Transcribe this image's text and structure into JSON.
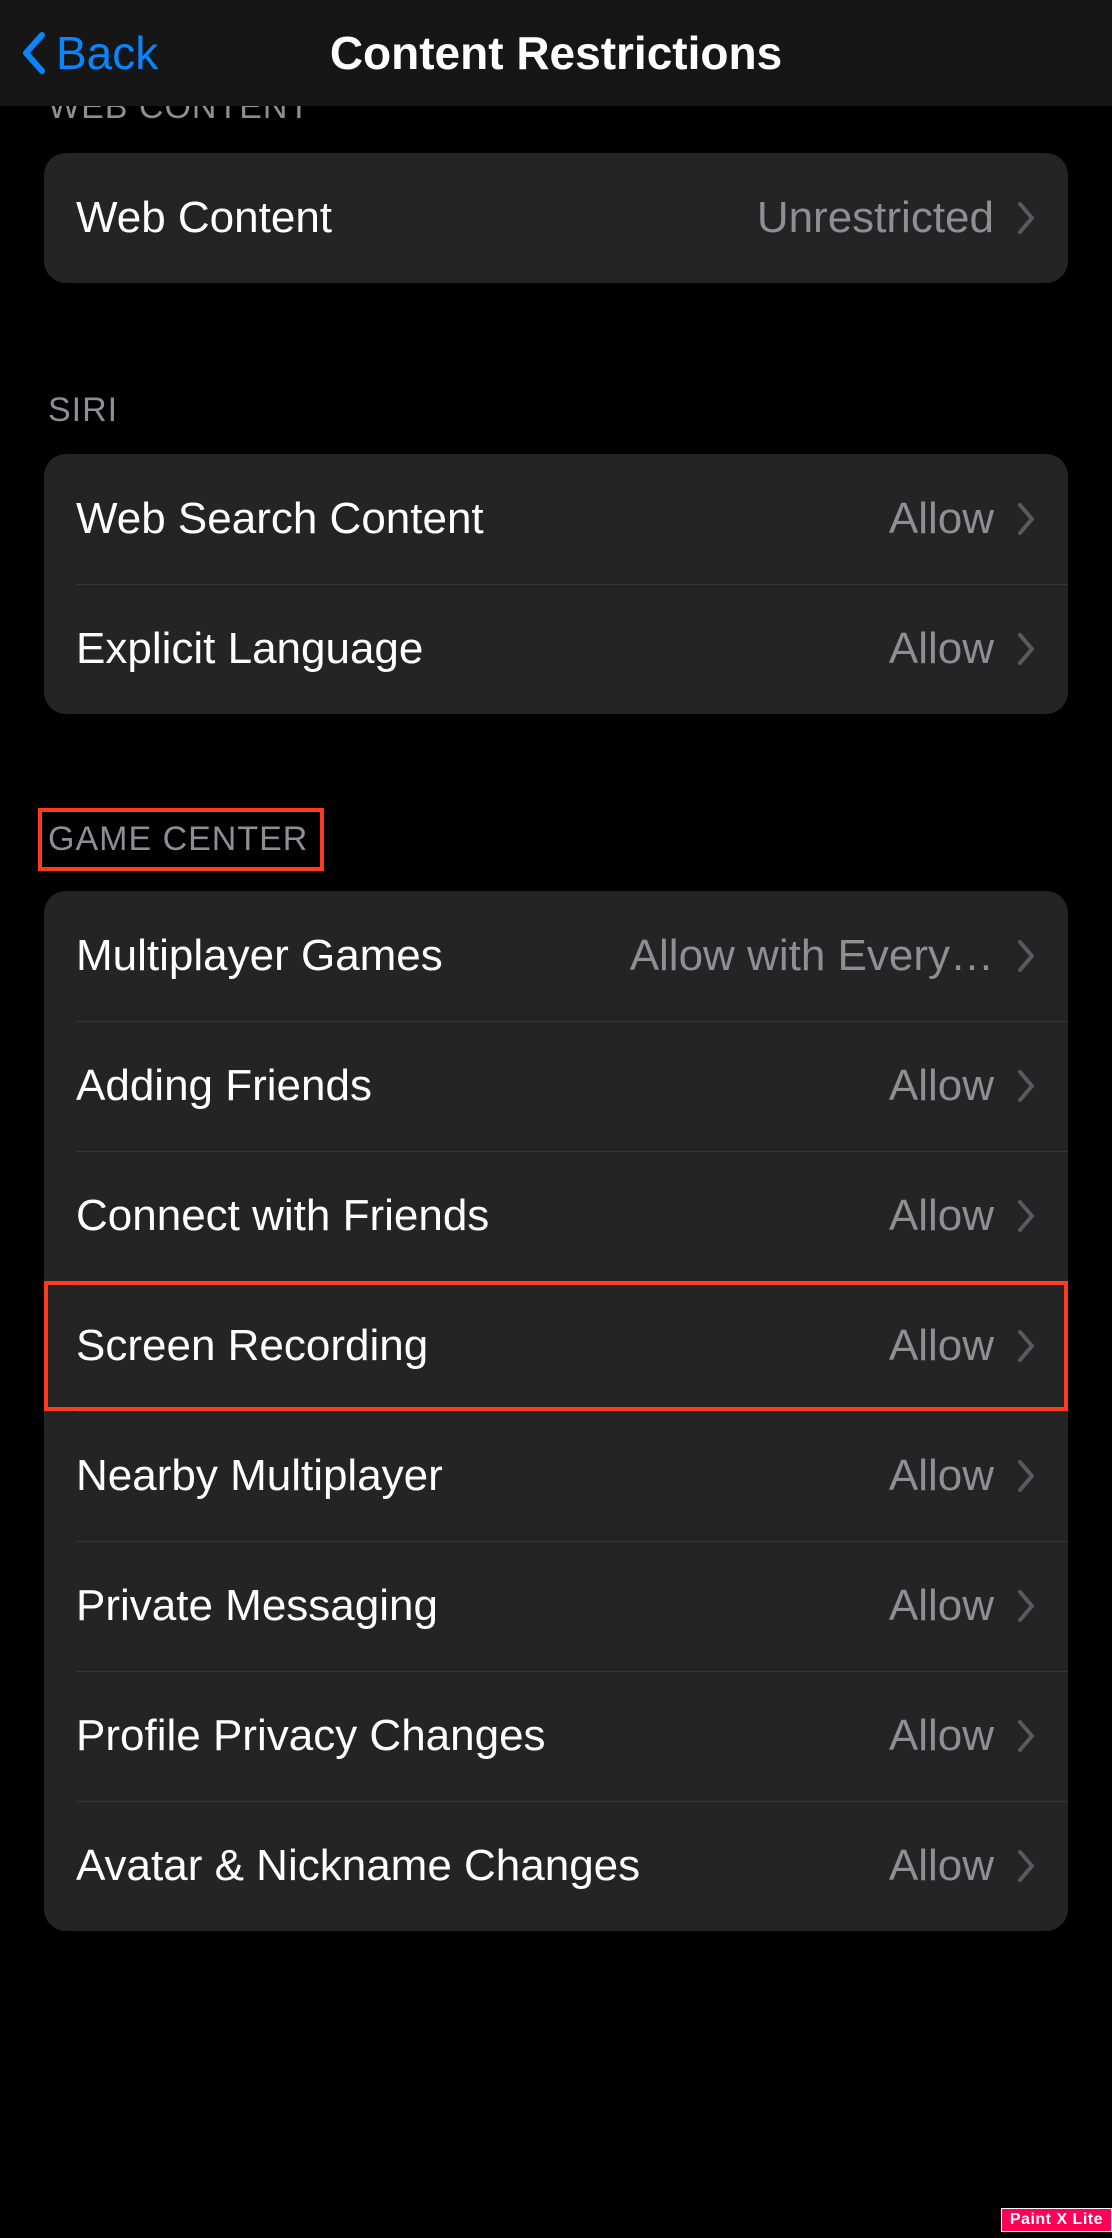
{
  "nav": {
    "back_label": "Back",
    "title": "Content Restrictions"
  },
  "sections": {
    "web": {
      "header": "WEB CONTENT",
      "items": [
        {
          "label": "Web Content",
          "value": "Unrestricted"
        }
      ]
    },
    "siri": {
      "header": "SIRI",
      "items": [
        {
          "label": "Web Search Content",
          "value": "Allow"
        },
        {
          "label": "Explicit Language",
          "value": "Allow"
        }
      ]
    },
    "gamecenter": {
      "header": "GAME CENTER",
      "items": [
        {
          "label": "Multiplayer Games",
          "value": "Allow with Every…"
        },
        {
          "label": "Adding Friends",
          "value": "Allow"
        },
        {
          "label": "Connect with Friends",
          "value": "Allow"
        },
        {
          "label": "Screen Recording",
          "value": "Allow"
        },
        {
          "label": "Nearby Multiplayer",
          "value": "Allow"
        },
        {
          "label": "Private Messaging",
          "value": "Allow"
        },
        {
          "label": "Profile Privacy Changes",
          "value": "Allow"
        },
        {
          "label": "Avatar & Nickname Changes",
          "value": "Allow"
        }
      ]
    }
  },
  "watermark": "Paint X Lite"
}
